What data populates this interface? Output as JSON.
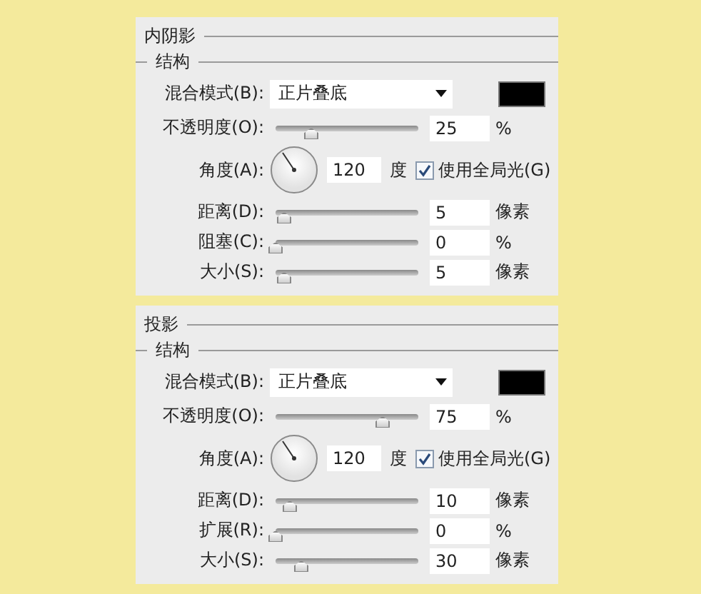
{
  "sections": [
    {
      "title": "内阴影",
      "subtitle": "结构",
      "blend_mode": {
        "label": "混合模式(B):",
        "value": "正片叠底"
      },
      "color": "#000000",
      "rows": [
        {
          "kind": "slider",
          "label": "不透明度(O):",
          "level": 0.25,
          "value": "25",
          "unit": "%"
        },
        {
          "kind": "angle",
          "label": "角度(A):",
          "value": "120",
          "unit": "度",
          "checkbox": {
            "label": "使用全局光(G)",
            "checked": true
          }
        },
        {
          "kind": "slider",
          "label": "距离(D):",
          "level": 0.06,
          "value": "5",
          "unit": "像素"
        },
        {
          "kind": "slider",
          "label": "阻塞(C):",
          "level": 0,
          "value": "0",
          "unit": "%"
        },
        {
          "kind": "slider",
          "label": "大小(S):",
          "level": 0.06,
          "value": "5",
          "unit": "像素"
        }
      ]
    },
    {
      "title": "投影",
      "subtitle": "结构",
      "blend_mode": {
        "label": "混合模式(B):",
        "value": "正片叠底"
      },
      "color": "#000000",
      "rows": [
        {
          "kind": "slider",
          "label": "不透明度(O):",
          "level": 0.75,
          "value": "75",
          "unit": "%"
        },
        {
          "kind": "angle",
          "label": "角度(A):",
          "value": "120",
          "unit": "度",
          "checkbox": {
            "label": "使用全局光(G)",
            "checked": true
          }
        },
        {
          "kind": "slider",
          "label": "距离(D):",
          "level": 0.1,
          "value": "10",
          "unit": "像素"
        },
        {
          "kind": "slider",
          "label": "扩展(R):",
          "level": 0,
          "value": "0",
          "unit": "%"
        },
        {
          "kind": "slider",
          "label": "大小(S):",
          "level": 0.18,
          "value": "30",
          "unit": "像素"
        }
      ]
    }
  ]
}
